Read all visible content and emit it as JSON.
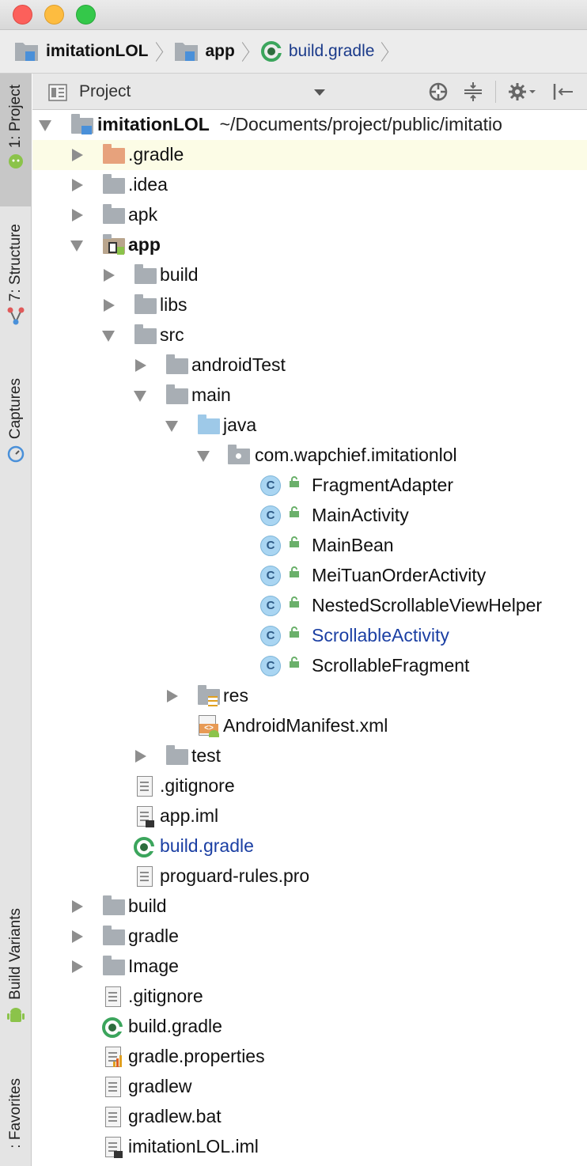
{
  "breadcrumb": {
    "items": [
      {
        "label": "imitationLOL"
      },
      {
        "label": "app"
      },
      {
        "label": "build.gradle"
      }
    ]
  },
  "toolstrip": {
    "tabs": [
      {
        "label": "1: Project"
      },
      {
        "label": "7: Structure"
      },
      {
        "label": "Captures"
      },
      {
        "label": "Build Variants"
      },
      {
        "label": ": Favorites"
      }
    ]
  },
  "panel": {
    "title": "Project",
    "buttons": [
      "locate-icon",
      "collapse-all-icon",
      "gear-icon",
      "hide-panel-icon"
    ]
  },
  "tree": {
    "root": {
      "name": "imitationLOL",
      "path": "~/Documents/project/public/imitatio"
    },
    "rows": [
      {
        "label": ".gradle"
      },
      {
        "label": ".idea"
      },
      {
        "label": "apk"
      },
      {
        "label": "app"
      },
      {
        "label": "build"
      },
      {
        "label": "libs"
      },
      {
        "label": "src"
      },
      {
        "label": "androidTest"
      },
      {
        "label": "main"
      },
      {
        "label": "java"
      },
      {
        "label": "com.wapchief.imitationlol"
      },
      {
        "label": "FragmentAdapter"
      },
      {
        "label": "MainActivity"
      },
      {
        "label": "MainBean"
      },
      {
        "label": "MeiTuanOrderActivity"
      },
      {
        "label": "NestedScrollableViewHelper"
      },
      {
        "label": "ScrollableActivity"
      },
      {
        "label": "ScrollableFragment"
      },
      {
        "label": "res"
      },
      {
        "label": "AndroidManifest.xml"
      },
      {
        "label": "test"
      },
      {
        "label": ".gitignore"
      },
      {
        "label": "app.iml"
      },
      {
        "label": "build.gradle"
      },
      {
        "label": "proguard-rules.pro"
      },
      {
        "label": "build"
      },
      {
        "label": "gradle"
      },
      {
        "label": "Image"
      },
      {
        "label": ".gitignore"
      },
      {
        "label": "build.gradle"
      },
      {
        "label": "gradle.properties"
      },
      {
        "label": "gradlew"
      },
      {
        "label": "gradlew.bat"
      },
      {
        "label": "imitationLOL.iml"
      }
    ]
  },
  "colors": {
    "link_blue": "#1b3fa3",
    "selection": "#fcfce6",
    "folder_grey": "#a8aeb4",
    "gradle_green": "#3ba55c"
  }
}
